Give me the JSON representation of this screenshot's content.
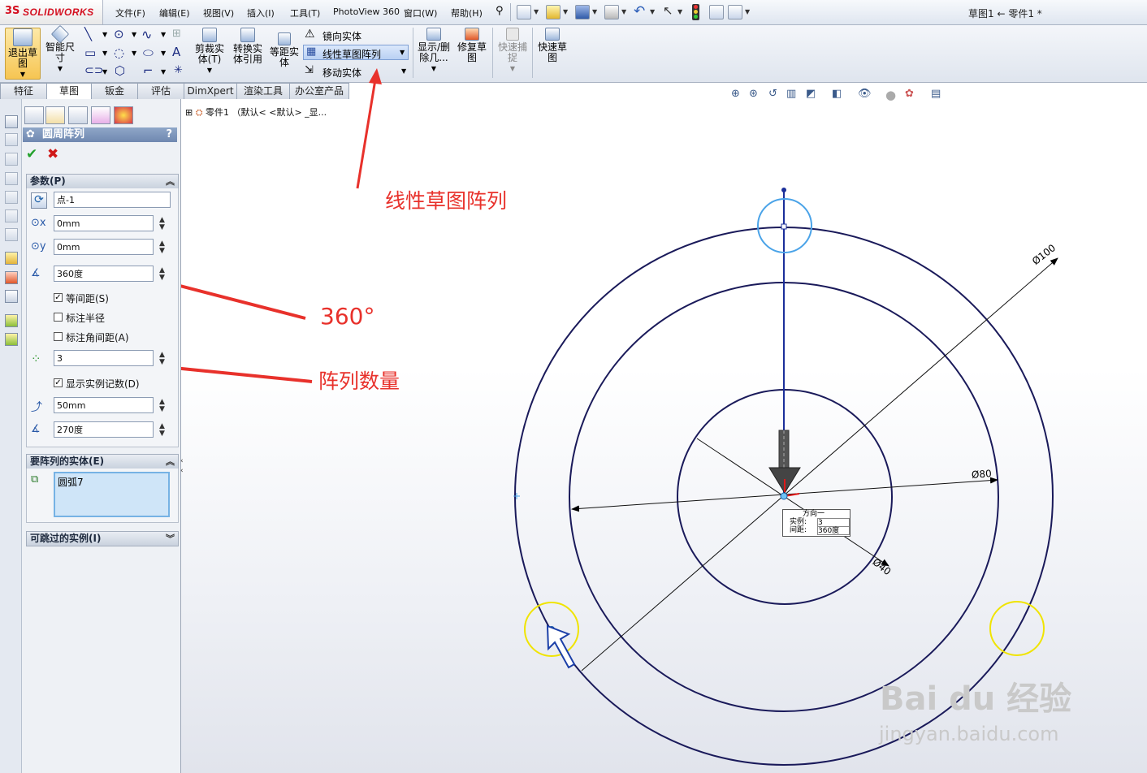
{
  "app": {
    "brand_ds": "3S",
    "brand_name": "SOLIDWORKS",
    "doc_title": "草图1 ← 零件1 *"
  },
  "menus": [
    "文件(F)",
    "编辑(E)",
    "视图(V)",
    "插入(I)",
    "工具(T)",
    "PhotoView 360",
    "窗口(W)",
    "帮助(H)"
  ],
  "commands": {
    "exit_sketch": [
      "退出草",
      "图"
    ],
    "smart_dim": [
      "智能尺",
      "寸"
    ],
    "trim": [
      "剪裁实",
      "体(T)"
    ],
    "convert": [
      "转换实",
      "体引用"
    ],
    "offset": [
      "等距实",
      "体"
    ],
    "mirror": "镜向实体",
    "linear_pattern": "线性草图阵列",
    "move": "移动实体",
    "show_delete": [
      "显示/删",
      "除几..."
    ],
    "repair": [
      "修复草",
      "图"
    ],
    "quick_snap": [
      "快速捕",
      "捉"
    ],
    "rapid_sketch": [
      "快速草",
      "图"
    ]
  },
  "tabs": [
    "特征",
    "草图",
    "钣金",
    "评估",
    "DimXpert",
    "渲染工具",
    "办公室产品"
  ],
  "active_tab": "草图",
  "tree": {
    "root": "零件1 （默认< <默认> _显..."
  },
  "property_manager": {
    "title": "圆周阵列",
    "help": "?",
    "params_header": "参数(P)",
    "center_point": "点-1",
    "center_x": "0mm",
    "center_y": "0mm",
    "angle": "360度",
    "equal_spacing": {
      "label": "等间距(S)",
      "checked": true
    },
    "dim_radius": {
      "label": "标注半径",
      "checked": false
    },
    "dim_angle_spacing": {
      "label": "标注角间距(A)",
      "checked": false
    },
    "instances": "3",
    "show_count": {
      "label": "显示实例记数(D)",
      "checked": true
    },
    "radius": "50mm",
    "arc_angle": "270度",
    "entities_header": "要阵列的实体(E)",
    "entity": "圆弧7",
    "skipped_header": "可跳过的实例(I)"
  },
  "annotations": {
    "linear_pattern": "线性草图阵列",
    "angle": "360°",
    "count": "阵列数量"
  },
  "sketch": {
    "dim_100": "Ø100",
    "dim_80": "Ø80",
    "dim_40": "Ø40",
    "callout_title": "方向一",
    "callout_instances_label": "实例:",
    "callout_instances": "3",
    "callout_spacing_label": "间距:",
    "callout_spacing": "360度"
  },
  "watermark": {
    "logo": "Bai du 经验",
    "url": "jingyan.baidu.com"
  },
  "colors": {
    "accent": "#e8312b",
    "sketch_line": "#1a1a5a",
    "selected_circle": "#4aa3e8",
    "preview_circle": "#f0e400"
  }
}
